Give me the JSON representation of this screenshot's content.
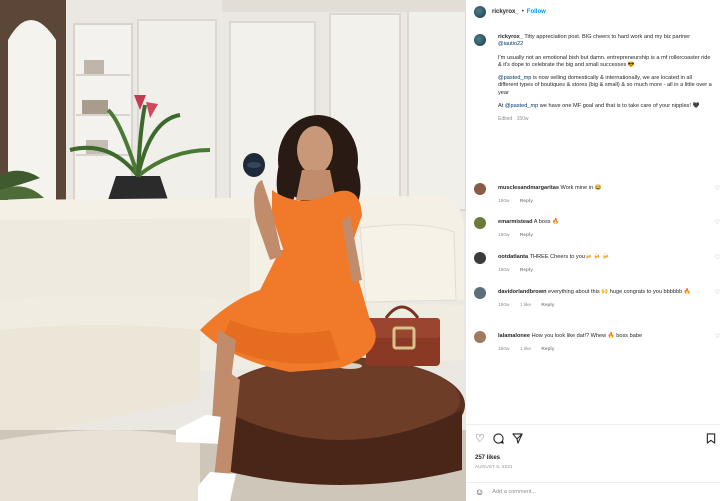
{
  "header": {
    "username": "rickyrox_",
    "separator": "•",
    "follow_label": "Follow"
  },
  "caption": {
    "username": "rickyrox_",
    "intro": "Titty appreciation post. BIG cheers to hard work and my biz partner",
    "mention_partner": "@iautio22",
    "para2": "I'm usually not an emotional bish but damn. entrepreneurship is a mf rollercoaster ride & it's dope to celebrate the big and small successes 😎",
    "para3_mention": "@pasted_mp",
    "para3": "is now selling domestically & internationally, we are located in all different types of boutiques & stores (big & small) & so much more - all in a little over a year",
    "para4_pre": "At",
    "para4_mention": "@pasted_mp",
    "para4_post": "we have one MF goal and that is to take care of your nipples! 🖤",
    "edited": "Edited",
    "time": "150w"
  },
  "comments": [
    {
      "username": "musclesandmargaritas",
      "text": "Work mine in 😂",
      "time": "150w",
      "reply": "Reply",
      "likes": "",
      "avatar_color": "#8a5a44"
    },
    {
      "username": "emarmistead",
      "text": "A boss 🔥",
      "time": "150w",
      "reply": "Reply",
      "likes": "",
      "avatar_color": "#6b7a3a"
    },
    {
      "username": "ootdatlanta",
      "text": "THREE Cheers to you🍻 🍻 🍻",
      "time": "150w",
      "reply": "Reply",
      "likes": "",
      "avatar_color": "#3a3a3a"
    },
    {
      "username": "davidorlandbrown",
      "text": "everything about this 🙌 huge congrats to you bbbbbb 🔥",
      "time": "150w",
      "reply": "Reply",
      "likes": "1 like",
      "avatar_color": "#5a6e7a"
    },
    {
      "username": "lalamalonee",
      "text": "How you look like dat!? Whew 🔥 boss babe",
      "time": "150w",
      "reply": "Reply",
      "likes": "1 like",
      "avatar_color": "#a07a5a"
    }
  ],
  "actions": {
    "like_icon": "heart-icon",
    "comment_icon": "comment-icon",
    "share_icon": "paper-plane-icon",
    "save_icon": "bookmark-icon",
    "likes": "257 likes",
    "date": "AUGUST 6, 2021"
  },
  "comment_box": {
    "emoji_icon": "smiley-icon",
    "placeholder": "Add a comment..."
  },
  "colors": {
    "follow_blue": "#0095f6",
    "link_blue": "#00376b",
    "muted_gray": "#8e8e8e",
    "dress_orange": "#f07a2a"
  }
}
